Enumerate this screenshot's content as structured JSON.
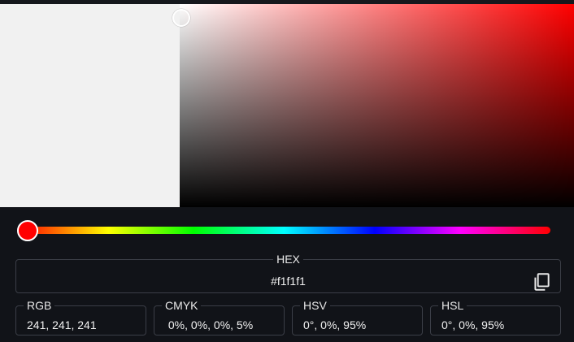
{
  "picker": {
    "preview_color": "#f1f1f1",
    "hue_color": "#ff0000",
    "hue_degrees": 0,
    "saturation": 0.0,
    "value": 0.95
  },
  "hex": {
    "label": "HEX",
    "value": "#f1f1f1",
    "copy_icon": "copy-icon"
  },
  "rgb": {
    "label": "RGB",
    "value": "241, 241, 241"
  },
  "cmyk": {
    "label": "CMYK",
    "value": " 0%, 0%, 0%, 5%"
  },
  "hsv": {
    "label": "HSV",
    "value": "0°, 0%, 95%"
  },
  "hsl": {
    "label": "HSL",
    "value": "0°, 0%, 95%"
  }
}
